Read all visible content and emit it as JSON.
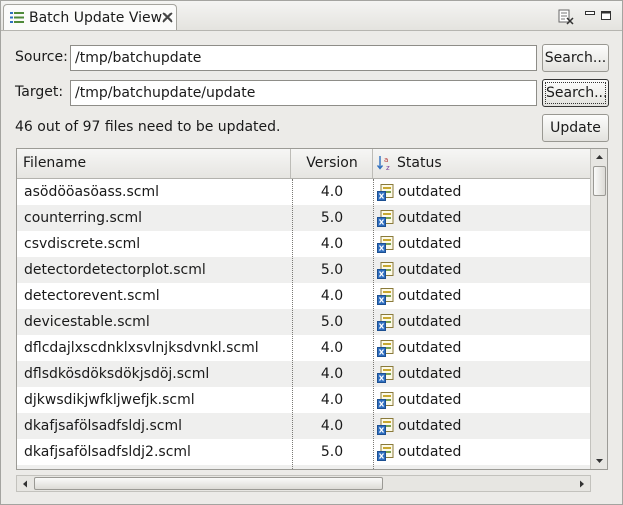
{
  "tab": {
    "title": "Batch Update View"
  },
  "form": {
    "source_label": "Source:",
    "source_value": "/tmp/batchupdate",
    "target_label": "Target:",
    "target_value": "/tmp/batchupdate/update",
    "search_label": "Search...",
    "summary": "46 out of 97 files need to be updated.",
    "update_label": "Update"
  },
  "table": {
    "columns": {
      "filename": "Filename",
      "version": "Version",
      "status": "Status"
    },
    "rows": [
      {
        "filename": "asödööasöass.scml",
        "version": "4.0",
        "status": "outdated"
      },
      {
        "filename": "counterring.scml",
        "version": "5.0",
        "status": "outdated"
      },
      {
        "filename": "csvdiscrete.scml",
        "version": "4.0",
        "status": "outdated"
      },
      {
        "filename": "detectordetectorplot.scml",
        "version": "5.0",
        "status": "outdated"
      },
      {
        "filename": "detectorevent.scml",
        "version": "4.0",
        "status": "outdated"
      },
      {
        "filename": "devicestable.scml",
        "version": "5.0",
        "status": "outdated"
      },
      {
        "filename": "dflcdajlxscdnklxsvlnjksdvnkl.scml",
        "version": "4.0",
        "status": "outdated"
      },
      {
        "filename": "dflsdkösdöksdökjsdöj.scml",
        "version": "4.0",
        "status": "outdated"
      },
      {
        "filename": "djkwsdikjwfkljwefjk.scml",
        "version": "4.0",
        "status": "outdated"
      },
      {
        "filename": "dkafjsafölsadfsldj.scml",
        "version": "4.0",
        "status": "outdated"
      },
      {
        "filename": "dkafjsafölsadfsldj2.scml",
        "version": "5.0",
        "status": "outdated"
      },
      {
        "filename": "dkafjsafölsadfsldj3.scml",
        "version": "5.0",
        "status": "outdated"
      }
    ]
  },
  "colors": {
    "row_alt": "#efefee",
    "accent_icon": "#2f6fc0"
  }
}
